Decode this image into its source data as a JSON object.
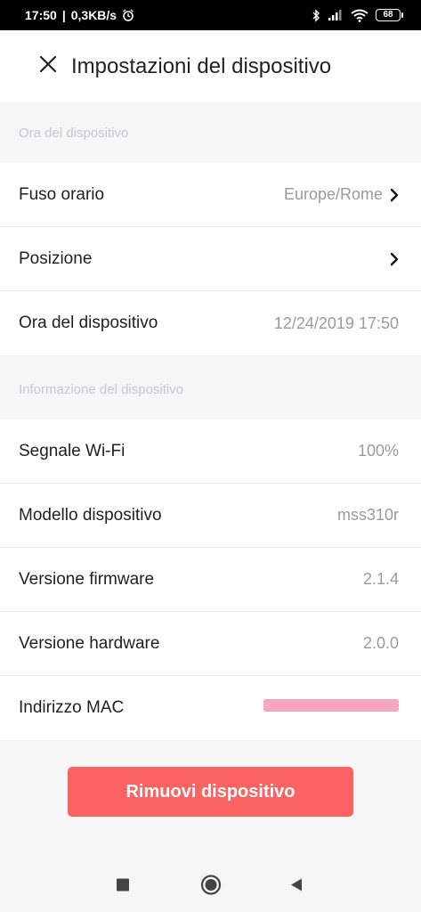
{
  "status_bar": {
    "time": "17:50",
    "net_speed": "0,3KB/s",
    "battery_level": "68",
    "icons": [
      "alarm-icon",
      "bluetooth-icon",
      "signal-icon",
      "wifi-icon",
      "battery-icon"
    ]
  },
  "header": {
    "close_icon": "close-icon",
    "title": "Impostazioni del dispositivo"
  },
  "sections": [
    {
      "title": "Ora del dispositivo",
      "rows": [
        {
          "label": "Fuso orario",
          "value": "Europe/Rome",
          "chevron": true
        },
        {
          "label": "Posizione",
          "value": "",
          "chevron": true
        },
        {
          "label": "Ora del dispositivo",
          "value": "12/24/2019 17:50",
          "chevron": false
        }
      ]
    },
    {
      "title": "Informazione del dispositivo",
      "rows": [
        {
          "label": "Segnale Wi-Fi",
          "value": "100%",
          "chevron": false
        },
        {
          "label": "Modello dispositivo",
          "value": "mss310r",
          "chevron": false
        },
        {
          "label": "Versione firmware",
          "value": "2.1.4",
          "chevron": false
        },
        {
          "label": "Versione hardware",
          "value": "2.0.0",
          "chevron": false
        },
        {
          "label": "Indirizzo MAC",
          "value": "",
          "chevron": false,
          "redacted": true
        }
      ]
    }
  ],
  "remove_button": {
    "label": "Rimuovi dispositivo",
    "color": "#fb6363"
  },
  "nav_bar": {
    "icons": [
      "recents-square-icon",
      "home-circle-icon",
      "back-triangle-icon"
    ]
  }
}
